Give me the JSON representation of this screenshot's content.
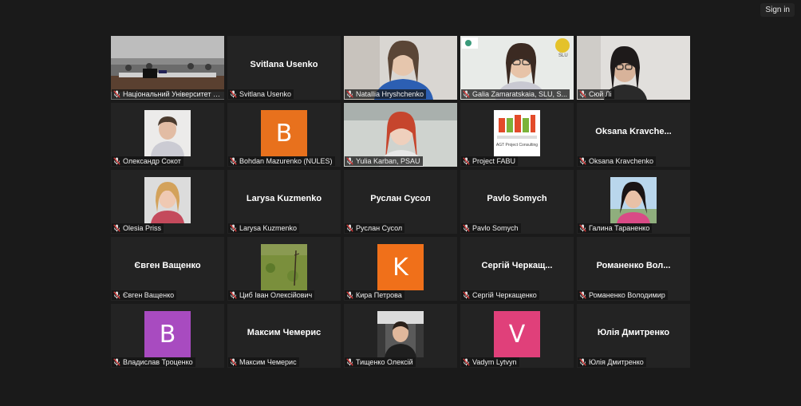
{
  "header": {
    "signin_label": "Sign in"
  },
  "participants": [
    {
      "label": "Національний Університет Бі...",
      "kind": "video",
      "scene": "conference"
    },
    {
      "label": "Svitlana Usenko",
      "kind": "name",
      "display_name": "Svitlana Usenko"
    },
    {
      "label": "Natallia Hryshchenko",
      "kind": "video",
      "scene": "woman-blue"
    },
    {
      "label": "Galia Zamaratskaia, SLU, S...",
      "kind": "video",
      "scene": "woman-glasses-logos"
    },
    {
      "label": "Сюй Лі",
      "kind": "video",
      "scene": "woman-light"
    },
    {
      "label": "Олександр Сокот",
      "kind": "photo",
      "scene": "man-portrait"
    },
    {
      "label": "Bohdan Mazurenko (NULES)",
      "kind": "letter",
      "letter": "B",
      "color": "#e8711d"
    },
    {
      "label": "Yulia Karban, PSAU",
      "kind": "video",
      "scene": "woman-redhair"
    },
    {
      "label": "Project FABU",
      "kind": "logo",
      "logo_text": "AGT Project Consulting"
    },
    {
      "label": "Oksana Kravchenko",
      "kind": "name",
      "display_name": "Oksana  Kravche..."
    },
    {
      "label": "Olesia Priss",
      "kind": "photo",
      "scene": "woman-portrait"
    },
    {
      "label": "Larysa Kuzmenko",
      "kind": "name",
      "display_name": "Larysa Kuzmenko"
    },
    {
      "label": "Руслан Сусол",
      "kind": "name",
      "display_name": "Руслан Сусол"
    },
    {
      "label": "Pavlo Somych",
      "kind": "name",
      "display_name": "Pavlo Somych"
    },
    {
      "label": "Галина Тараненко",
      "kind": "photo",
      "scene": "woman-darkhair"
    },
    {
      "label": "Євген Ващенко",
      "kind": "name",
      "display_name": "Євген Ващенко"
    },
    {
      "label": "Циб Іван Олексійович",
      "kind": "photo",
      "scene": "field"
    },
    {
      "label": "Кира Петрова",
      "kind": "letter",
      "letter": "K",
      "color": "#f0701a"
    },
    {
      "label": "Сергій Черкащенко",
      "kind": "name",
      "display_name": "Сергій  Черкащ..."
    },
    {
      "label": "Романенко Володимир",
      "kind": "name",
      "display_name": "Романенко  Вол..."
    },
    {
      "label": "Владислав Троценко",
      "kind": "letter",
      "letter": "B",
      "color": "#a84bc0"
    },
    {
      "label": "Максим Чемерис",
      "kind": "name",
      "display_name": "Максим Чемерис"
    },
    {
      "label": "Тищенко Олексій",
      "kind": "photo",
      "scene": "man-car"
    },
    {
      "label": "Vadym Lytvyn",
      "kind": "letter",
      "letter": "V",
      "color": "#e0407a"
    },
    {
      "label": "Юлія Дмитренко",
      "kind": "name",
      "display_name": "Юлія Дмитренко"
    }
  ],
  "colors": {
    "active_outline": "#c8e65c",
    "mic_muted": "#d93a3a",
    "tile_bg": "#232323"
  }
}
